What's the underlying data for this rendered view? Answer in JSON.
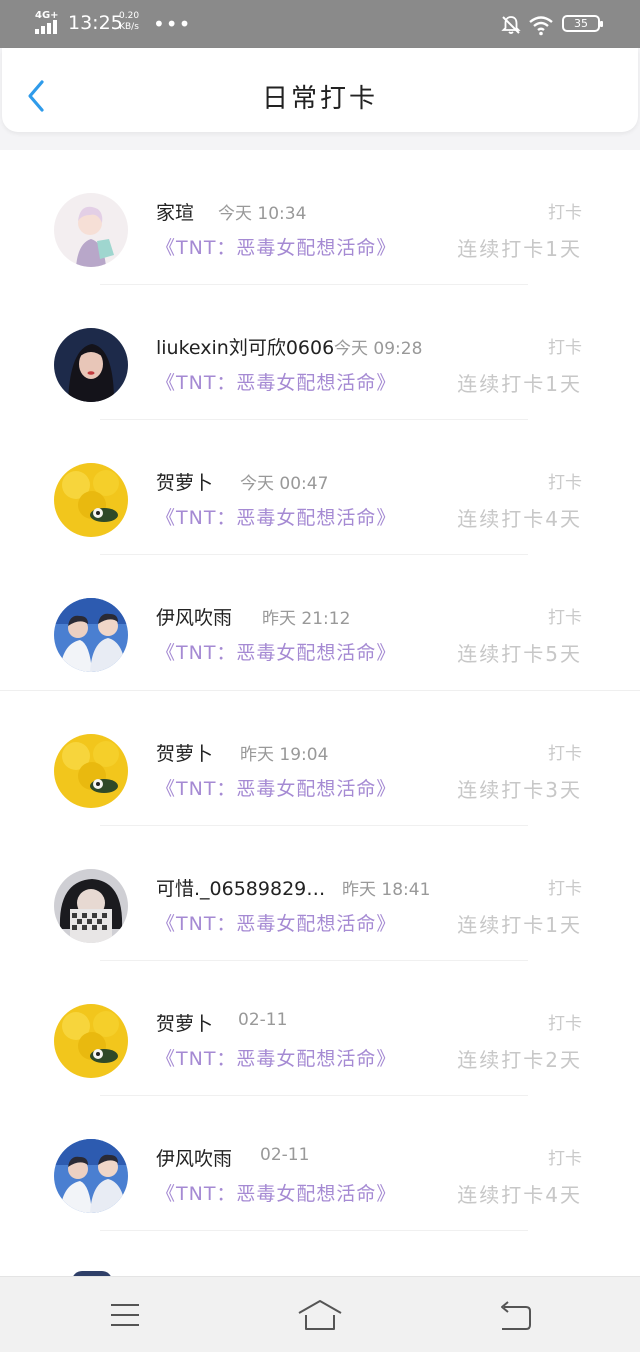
{
  "status_bar": {
    "network": "4G+",
    "time": "13:25",
    "speed_value": "0.20",
    "speed_unit": "KB/s",
    "dots": "•••",
    "battery": "35"
  },
  "header": {
    "title": "日常打卡"
  },
  "entries": [
    {
      "name": "家瑄",
      "time": "今天 10:34",
      "action": "打卡",
      "book": "《TNT：恶毒女配想活命》",
      "streak": "连续打卡1天"
    },
    {
      "name": "liukexin刘可欣0606",
      "time": "今天 09:28",
      "action": "打卡",
      "book": "《TNT：恶毒女配想活命》",
      "streak": "连续打卡1天"
    },
    {
      "name": "贺萝卜",
      "time": "今天 00:47",
      "action": "打卡",
      "book": "《TNT：恶毒女配想活命》",
      "streak": "连续打卡4天"
    },
    {
      "name": "伊风吹雨",
      "time": "昨天 21:12",
      "action": "打卡",
      "book": "《TNT：恶毒女配想活命》",
      "streak": "连续打卡5天"
    },
    {
      "name": "贺萝卜",
      "time": "昨天 19:04",
      "action": "打卡",
      "book": "《TNT：恶毒女配想活命》",
      "streak": "连续打卡3天"
    },
    {
      "name": "可惜._06589829…",
      "time": "昨天 18:41",
      "action": "打卡",
      "book": "《TNT：恶毒女配想活命》",
      "streak": "连续打卡1天"
    },
    {
      "name": "贺萝卜",
      "time": "02-11",
      "action": "打卡",
      "book": "《TNT：恶毒女配想活命》",
      "streak": "连续打卡2天"
    },
    {
      "name": "伊风吹雨",
      "time": "02-11",
      "action": "打卡",
      "book": "《TNT：恶毒女配想活命》",
      "streak": "连续打卡4天"
    }
  ],
  "icons": {
    "back": "chevron-left-icon",
    "menu": "menu-icon",
    "home": "home-icon",
    "back_nav": "return-icon"
  },
  "colors": {
    "accent_blue": "#2f9bea",
    "book_purple": "#a58ad3",
    "status_bar": "#8a8a8a"
  }
}
